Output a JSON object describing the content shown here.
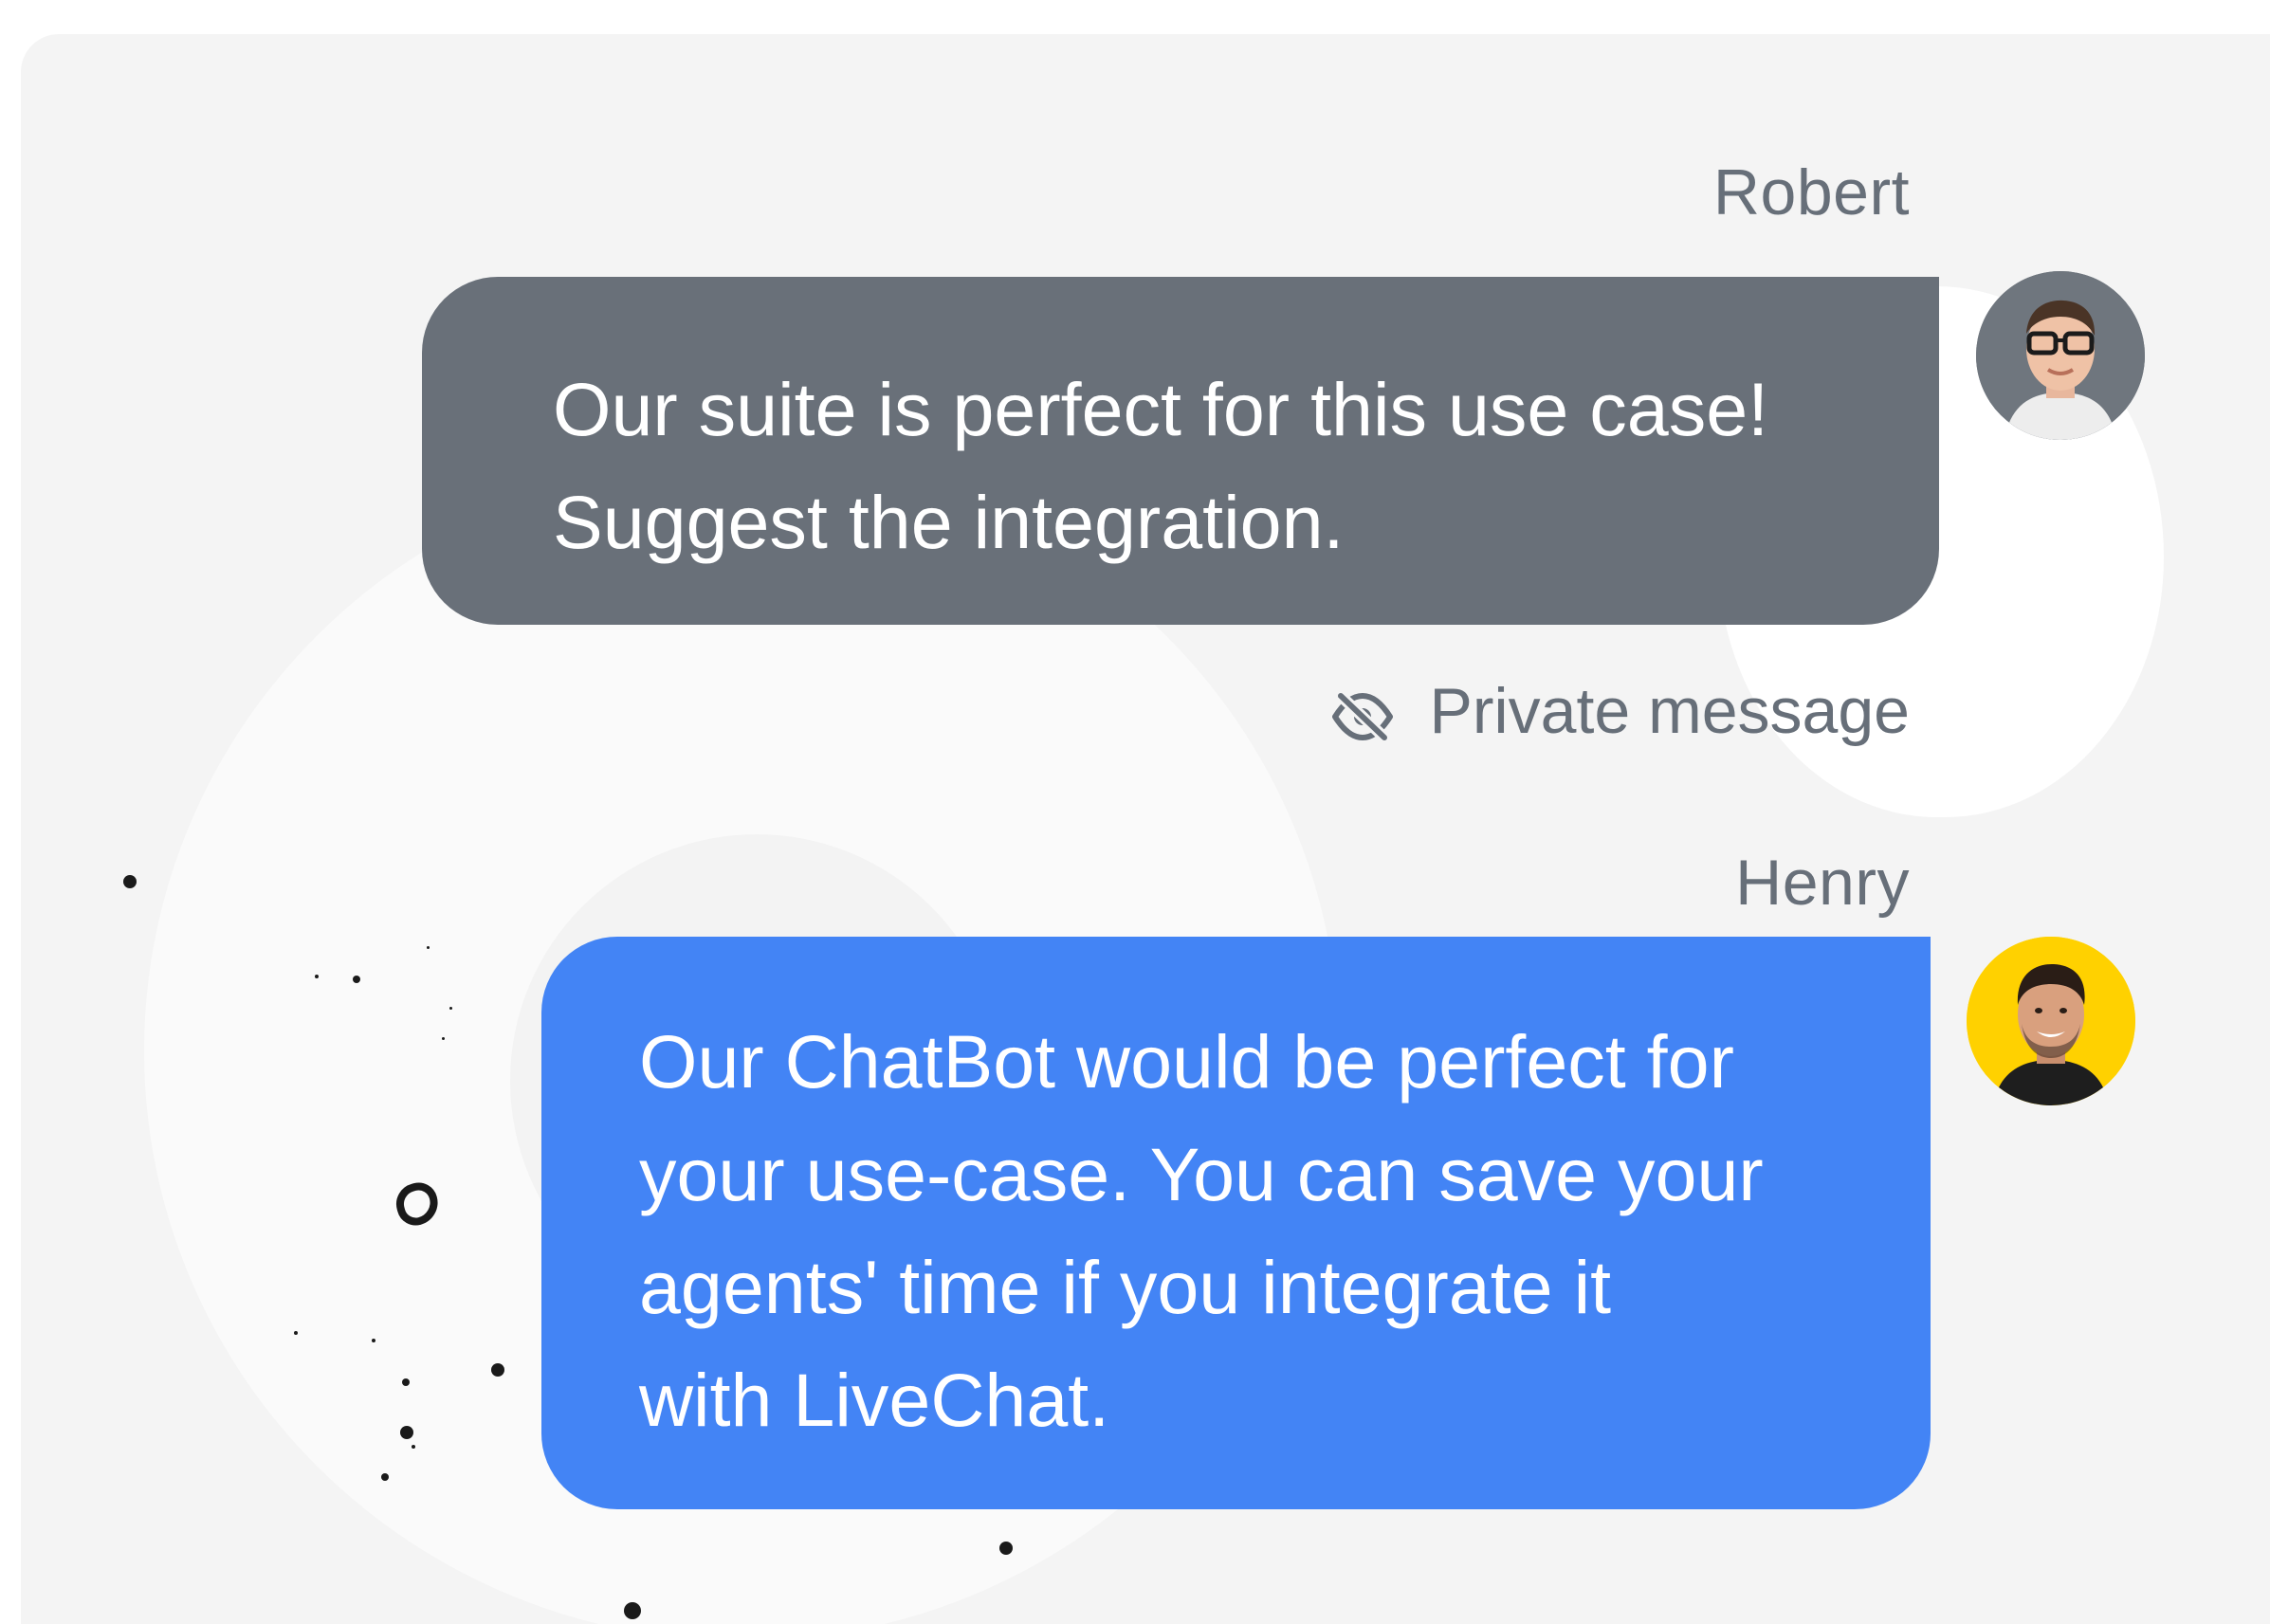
{
  "messages": [
    {
      "author": "Robert",
      "text": "Our suite is perfect for this use case!\nSuggest the integration.",
      "note": "Private message",
      "note_icon": "eye-off-icon",
      "bubble_color": "#697079"
    },
    {
      "author": "Henry",
      "text": "Our ChatBot would be perfect for\nyour use-case. You can save your\nagents' time if you integrate it\nwith LiveChat.",
      "bubble_color": "#4384f5",
      "avatar_bg": "#ffd100"
    }
  ]
}
